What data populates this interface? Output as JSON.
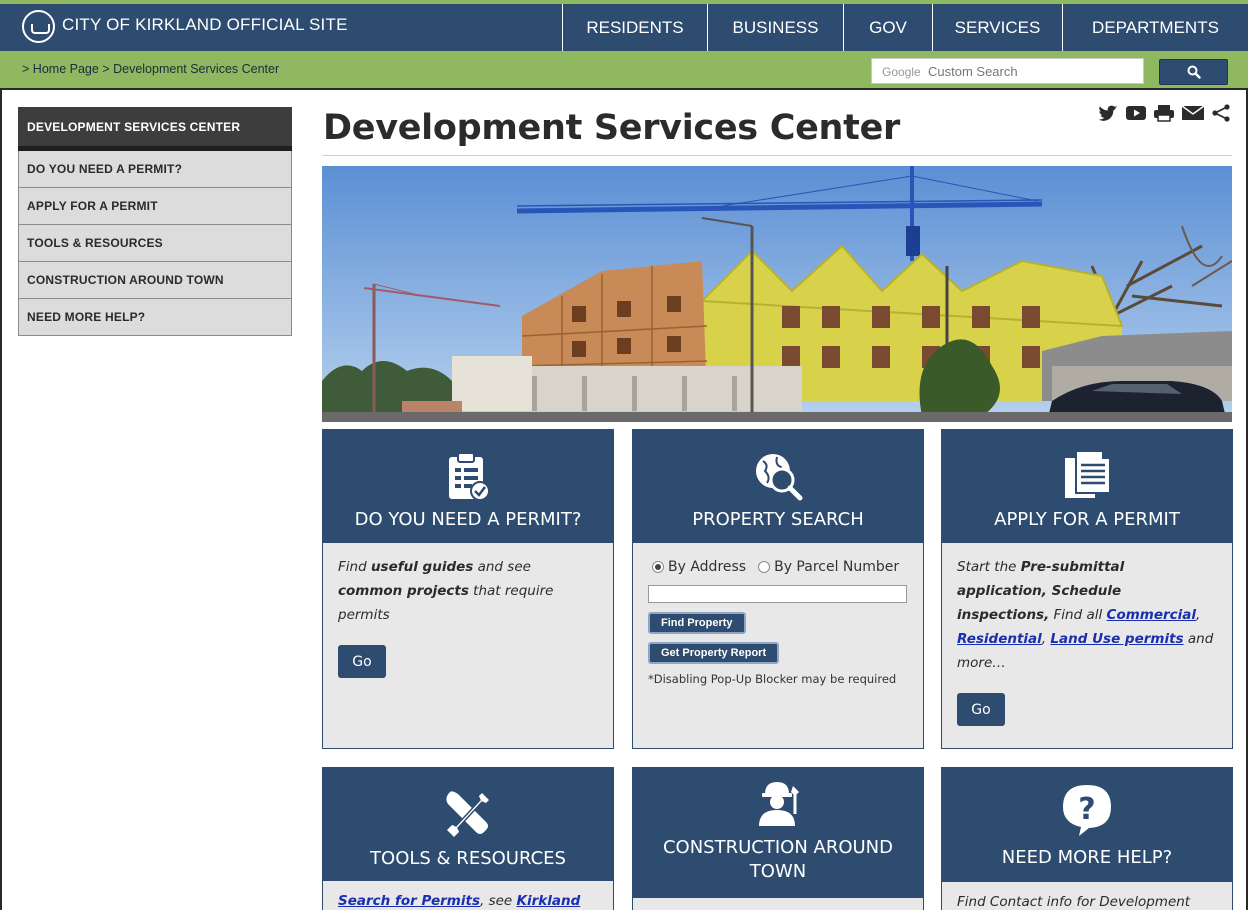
{
  "header": {
    "site_title": "CITY OF KIRKLAND OFFICIAL SITE",
    "nav": [
      "RESIDENTS",
      "BUSINESS",
      "GOV",
      "SERVICES",
      "DEPARTMENTS"
    ]
  },
  "breadcrumb": {
    "prefix": ">",
    "home": "Home Page",
    "separator": ">",
    "current": "Development Services Center"
  },
  "search": {
    "brand": "Google",
    "placeholder": "Custom Search"
  },
  "sidebar": {
    "heading": "DEVELOPMENT SERVICES CENTER",
    "items": [
      "DO YOU NEED A PERMIT?",
      "APPLY FOR A PERMIT",
      "TOOLS & RESOURCES",
      "CONSTRUCTION AROUND TOWN",
      "NEED MORE HELP?"
    ]
  },
  "page": {
    "title": "Development Services Center"
  },
  "cards": {
    "permit": {
      "title": "DO YOU NEED A PERMIT?",
      "t1": "Find ",
      "b1": "useful guides",
      "t2": " and see ",
      "b2": "common projects",
      "t3": " that require permits",
      "button": "Go"
    },
    "property": {
      "title": "PROPERTY SEARCH",
      "radio_address": "By Address",
      "radio_parcel": "By Parcel Number",
      "find_button": "Find Property",
      "report_button": "Get Property Report",
      "note": "*Disabling Pop-Up Blocker may be required"
    },
    "apply": {
      "title": "APPLY FOR A PERMIT",
      "t1": "Start the ",
      "b1": "Pre-submittal application, Schedule inspections,",
      "t2": " Find all ",
      "link1": "Commercial",
      "sep1": ", ",
      "link2": "Residential",
      "sep2": ", ",
      "link3": "Land Use permits",
      "t3": " and more…",
      "button": "Go"
    },
    "tools": {
      "title": "TOOLS & RESOURCES",
      "link1": "Search for Permits",
      "t1": ", see ",
      "link2": "Kirkland Maps",
      "t2": ","
    },
    "construction": {
      "title_line1": "CONSTRUCTION AROUND",
      "title_line2": "TOWN"
    },
    "help": {
      "title": "NEED MORE HELP?",
      "text": "Find Contact info for Development"
    }
  }
}
